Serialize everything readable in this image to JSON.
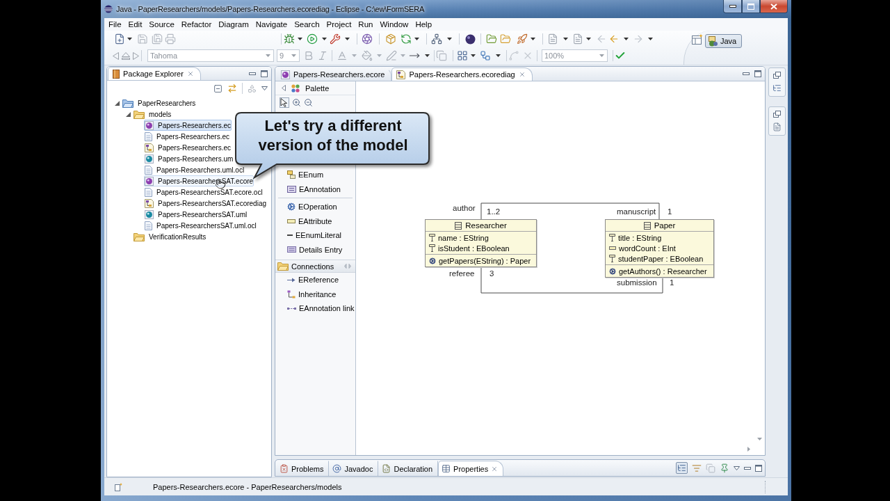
{
  "window": {
    "title": "Java - PaperResearchers/models/Papers-Researchers.ecorediag - Eclipse - C:\\ew\\FormSERA"
  },
  "menu": [
    "File",
    "Edit",
    "Source",
    "Refactor",
    "Diagram",
    "Navigate",
    "Search",
    "Project",
    "Run",
    "Window",
    "Help"
  ],
  "toolbar": {
    "font": "Tahoma",
    "font_size": "9",
    "zoom": "100%"
  },
  "perspective": {
    "label": "Java",
    "selected": true
  },
  "package_explorer": {
    "title": "Package Explorer",
    "tree": [
      {
        "label": "PaperResearchers",
        "kind": "project",
        "expanded": true,
        "selected": false,
        "hovered": false,
        "children": [
          {
            "label": "models",
            "kind": "folder",
            "expanded": true,
            "selected": false,
            "hovered": false,
            "children": [
              {
                "label": "Papers-Researchers.ec",
                "kind": "ecore",
                "selected": true,
                "hovered": false
              },
              {
                "label": "Papers-Researchers.ec",
                "kind": "ocl",
                "selected": false,
                "hovered": false
              },
              {
                "label": "Papers-Researchers.ec",
                "kind": "diagram",
                "selected": false,
                "hovered": false
              },
              {
                "label": "Papers-Researchers.um",
                "kind": "uml",
                "selected": false,
                "hovered": false
              },
              {
                "label": "Papers-Researchers.uml.ocl",
                "kind": "ocl",
                "selected": false,
                "hovered": false
              },
              {
                "label": "Papers-ResearchersSAT.ecore",
                "kind": "ecore",
                "selected": false,
                "hovered": true
              },
              {
                "label": "Papers-ResearchersSAT.ecore.ocl",
                "kind": "ocl",
                "selected": false,
                "hovered": false
              },
              {
                "label": "Papers-ResearchersSAT.ecorediag",
                "kind": "diagram",
                "selected": false,
                "hovered": false
              },
              {
                "label": "Papers-ResearchersSAT.uml",
                "kind": "uml",
                "selected": false,
                "hovered": false
              },
              {
                "label": "Papers-ResearchersSAT.uml.ocl",
                "kind": "ocl",
                "selected": false,
                "hovered": false
              }
            ]
          },
          {
            "label": "VerificationResults",
            "kind": "folder",
            "selected": false,
            "hovered": false
          }
        ]
      }
    ]
  },
  "editor": {
    "tabs": [
      {
        "label": "Papers-Researchers.ecore",
        "kind": "ecore",
        "selected": false
      },
      {
        "label": "Papers-Researchers.ecorediag",
        "kind": "diagram",
        "selected": true
      }
    ],
    "palette": {
      "title": "Palette",
      "groups": [
        {
          "items": [
            {
              "label": "EEnum",
              "kind": "enum"
            },
            {
              "label": "EAnnotation",
              "kind": "annotation"
            }
          ]
        },
        {
          "items": [
            {
              "label": "EOperation",
              "kind": "operation"
            },
            {
              "label": "EAttribute",
              "kind": "attribute"
            },
            {
              "label": "EEnumLiteral",
              "kind": "literal"
            },
            {
              "label": "Details Entry",
              "kind": "entry"
            }
          ]
        },
        {
          "title": "Connections",
          "expanded": true,
          "items": [
            {
              "label": "EReference",
              "kind": "reference"
            },
            {
              "label": "Inheritance",
              "kind": "inheritance"
            },
            {
              "label": "EAnnotation link",
              "kind": "link"
            }
          ]
        }
      ]
    },
    "diagram": {
      "classes": [
        {
          "name": "Researcher",
          "attributes": [
            {
              "kind": "pin",
              "text": "name : EString"
            },
            {
              "kind": "pin",
              "text": "isStudent : EBoolean"
            }
          ],
          "operations": [
            "getPapers(EString) : Paper"
          ]
        },
        {
          "name": "Paper",
          "attributes": [
            {
              "kind": "pin",
              "text": "title : EString"
            },
            {
              "kind": "bar",
              "text": "wordCount : EInt"
            },
            {
              "kind": "pin",
              "text": "studentPaper : EBoolean"
            }
          ],
          "operations": [
            "getAuthors() : Researcher"
          ]
        }
      ],
      "associations": [
        {
          "source_role": "author",
          "source_multiplicity": "1..2",
          "target_role": "manuscript",
          "target_multiplicity": "1"
        },
        {
          "source_role": "referee",
          "source_multiplicity": "3",
          "target_role": "submission",
          "target_multiplicity": "1"
        }
      ]
    }
  },
  "bottom_views": {
    "tabs": [
      {
        "label": "Problems",
        "kind": "problems",
        "selected": false
      },
      {
        "label": "Javadoc",
        "kind": "javadoc",
        "selected": false
      },
      {
        "label": "Declaration",
        "kind": "declaration",
        "selected": false
      },
      {
        "label": "Properties",
        "kind": "properties",
        "selected": true
      }
    ]
  },
  "status_bar": {
    "text": "Papers-Researchers.ecore - PaperResearchers/models"
  },
  "callout": {
    "text": "Let's try a different version of the model"
  }
}
